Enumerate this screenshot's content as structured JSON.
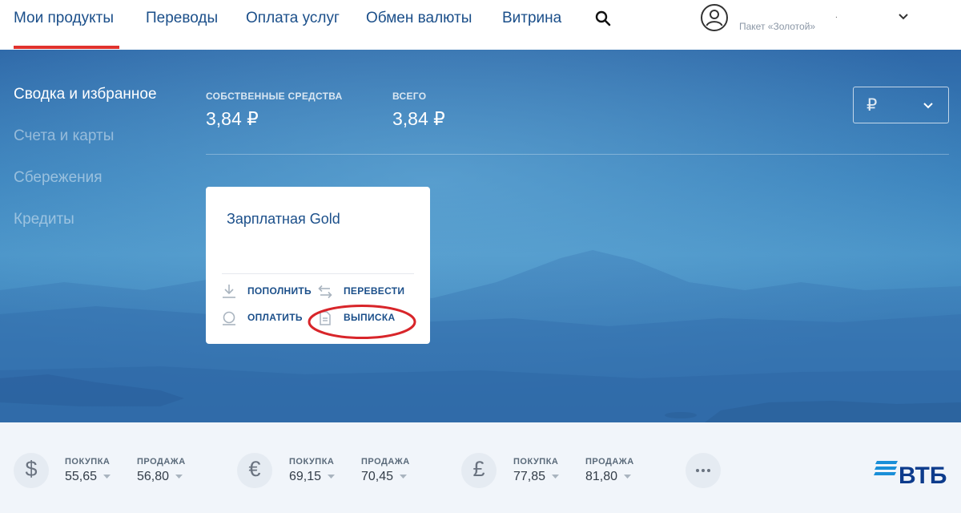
{
  "nav": {
    "items": [
      "Мои продукты",
      "Переводы",
      "Оплата услуг",
      "Обмен валюты",
      "Витрина"
    ],
    "package_label": "Пакет «Золотой»",
    "mark": "."
  },
  "sidebar": {
    "items": [
      "Сводка и избранное",
      "Счета и карты",
      "Сбережения",
      "Кредиты"
    ],
    "active_index": 0
  },
  "balance": {
    "own_label": "СОБСТВЕННЫЕ СРЕДСТВА",
    "own_value": "3,84 ₽",
    "total_label": "ВСЕГО",
    "total_value": "3,84 ₽",
    "currency_symbol": "₽"
  },
  "card": {
    "title": "Зарплатная Gold",
    "actions": {
      "topup": "ПОПОЛНИТЬ",
      "transfer": "ПЕРЕВЕСТИ",
      "pay": "ОПЛАТИТЬ",
      "statement": "ВЫПИСКА"
    }
  },
  "rates": [
    {
      "symbol": "$",
      "buy_label": "ПОКУПКА",
      "buy": "55,65",
      "sell_label": "ПРОДАЖА",
      "sell": "56,80"
    },
    {
      "symbol": "€",
      "buy_label": "ПОКУПКА",
      "buy": "69,15",
      "sell_label": "ПРОДАЖА",
      "sell": "70,45"
    },
    {
      "symbol": "£",
      "buy_label": "ПОКУПКА",
      "buy": "77,85",
      "sell_label": "ПРОДАЖА",
      "sell": "81,80"
    }
  ],
  "brand": {
    "logo_text": "ВТБ",
    "primary": "#1b4f8a",
    "accent_red": "#e0322d",
    "logo_blue": "#1a8fd8"
  }
}
